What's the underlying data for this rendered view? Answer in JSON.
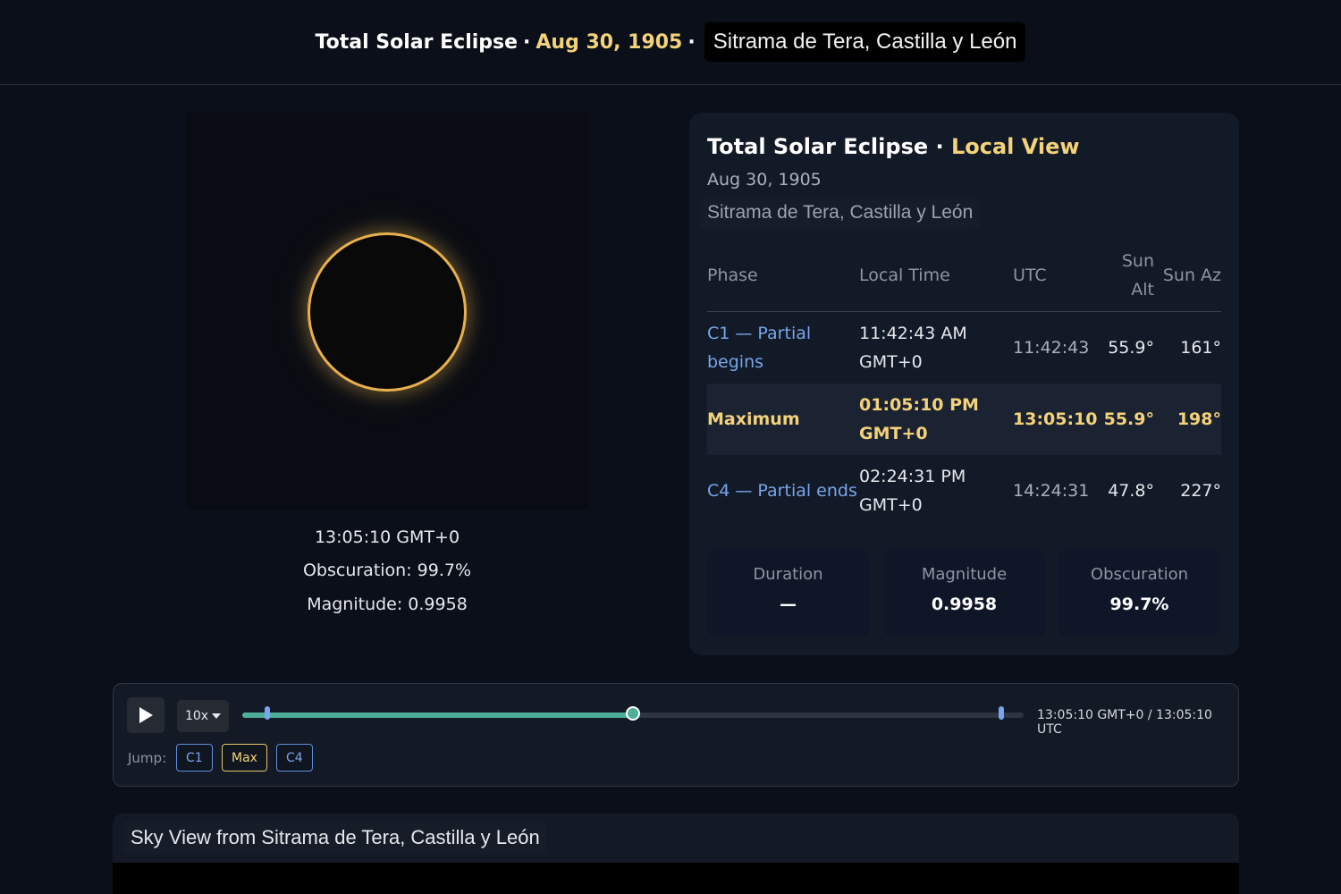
{
  "header": {
    "title": "Total Solar Eclipse",
    "separator": "·",
    "date": "Aug 30, 1905",
    "location": "Sitrama de Tera, Castilla y León"
  },
  "eclipse_view": {
    "time": "13:05:10 GMT+0",
    "obscuration": "Obscuration: 99.7%",
    "magnitude": "Magnitude: 0.9958",
    "corona_color": "#e8b04d"
  },
  "card": {
    "title": "Total Solar Eclipse",
    "separator": "·",
    "subtitle": "Local View",
    "date": "Aug 30, 1905",
    "location": "Sitrama de Tera, Castilla y León",
    "columns": {
      "phase": "Phase",
      "local": "Local Time",
      "utc": "UTC",
      "alt": "Sun Alt",
      "az": "Sun Az"
    },
    "rows": [
      {
        "phase": "C1 — Partial begins",
        "local": "11:42:43 AM GMT+0",
        "utc": "11:42:43",
        "alt": "55.9°",
        "az": "161°"
      },
      {
        "phase": "Maximum",
        "local": "01:05:10 PM GMT+0",
        "utc": "13:05:10",
        "alt": "55.9°",
        "az": "198°"
      },
      {
        "phase": "C4 — Partial ends",
        "local": "02:24:31 PM GMT+0",
        "utc": "14:24:31",
        "alt": "47.8°",
        "az": "227°"
      }
    ],
    "stats": [
      {
        "label": "Duration",
        "value": "—"
      },
      {
        "label": "Magnitude",
        "value": "0.9958"
      },
      {
        "label": "Obscuration",
        "value": "99.7%"
      }
    ]
  },
  "timeline": {
    "speed": "10x",
    "progress": 0.5,
    "c1_marker": 0.029,
    "c4_marker": 0.968,
    "readout": "13:05:10 GMT+0 / 13:05:10 UTC",
    "jump_label": "Jump:",
    "jump_buttons": [
      "C1",
      "Max",
      "C4"
    ],
    "accent": "#4fae99"
  },
  "sky": {
    "title": "Sky View from Sitrama de Tera, Castilla y León"
  }
}
